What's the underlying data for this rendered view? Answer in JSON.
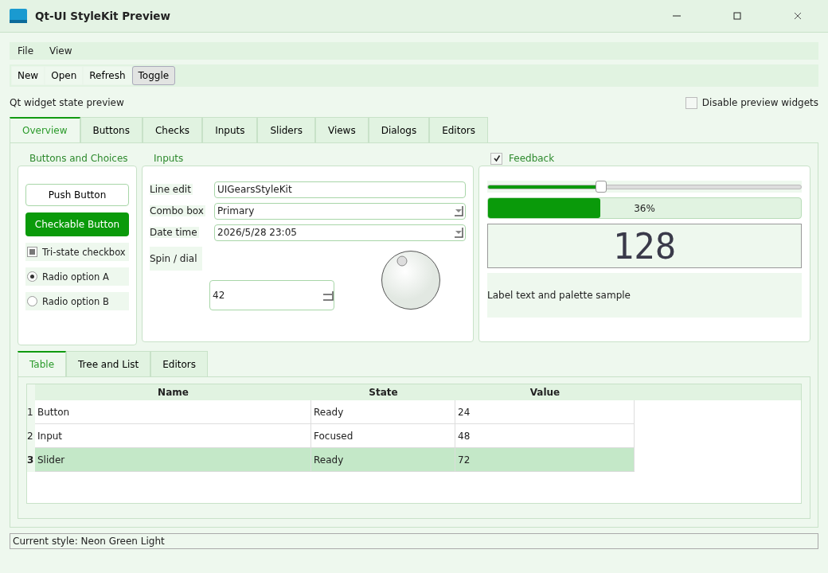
{
  "window": {
    "title": "Qt-UI StyleKit Preview"
  },
  "menu": [
    "File",
    "View"
  ],
  "toolbar": [
    {
      "label": "New",
      "selected": false
    },
    {
      "label": "Open",
      "selected": false
    },
    {
      "label": "Refresh",
      "selected": false
    },
    {
      "label": "Toggle",
      "selected": true
    }
  ],
  "header": {
    "text": "Qt widget state preview",
    "disable_checkbox": {
      "label": "Disable preview widgets",
      "checked": false
    }
  },
  "tabs": [
    {
      "label": "Overview",
      "selected": true
    },
    {
      "label": "Buttons",
      "selected": false
    },
    {
      "label": "Checks",
      "selected": false
    },
    {
      "label": "Inputs",
      "selected": false
    },
    {
      "label": "Sliders",
      "selected": false
    },
    {
      "label": "Views",
      "selected": false
    },
    {
      "label": "Dialogs",
      "selected": false
    },
    {
      "label": "Editors",
      "selected": false
    }
  ],
  "buttons_group": {
    "title": "Buttons and Choices",
    "push_button": "Push Button",
    "checkable_button": {
      "label": "Checkable Button",
      "checked": true
    },
    "tristate": {
      "label": "Tri-state checkbox",
      "partial": true
    },
    "radios": [
      {
        "label": "Radio option A",
        "selected": true
      },
      {
        "label": "Radio option B",
        "selected": false
      }
    ]
  },
  "inputs_group": {
    "title": "Inputs",
    "fields": [
      {
        "kind": "text",
        "label": "Line edit",
        "value": "UIGearsStyleKit"
      },
      {
        "kind": "combo",
        "label": "Combo box",
        "value": "Primary"
      },
      {
        "kind": "combo",
        "label": "Date time",
        "value": "2026/5/28 23:05"
      }
    ],
    "spin": {
      "label": "Spin / dial",
      "value": "42"
    }
  },
  "feedback_group": {
    "title": "Feedback",
    "checked": true,
    "slider": {
      "level": 0.36
    },
    "progress": {
      "level": 0.36,
      "reading": "36%"
    },
    "lcd": "128",
    "label": "Label text and palette sample"
  },
  "bottom_tabs": [
    {
      "label": "Table",
      "selected": true
    },
    {
      "label": "Tree and List",
      "selected": false
    },
    {
      "label": "Editors",
      "selected": false
    }
  ],
  "table": {
    "columns": [
      "Name",
      "State",
      "Value"
    ],
    "rows": [
      {
        "number": "1",
        "cells": [
          "Button",
          "Ready",
          "24"
        ],
        "selected": false
      },
      {
        "number": "2",
        "cells": [
          "Input",
          "Focused",
          "48"
        ],
        "selected": false
      },
      {
        "number": "3",
        "cells": [
          "Slider",
          "Ready",
          "72"
        ],
        "selected": true
      }
    ]
  },
  "status_bar": "Current style: Neon Green Light"
}
